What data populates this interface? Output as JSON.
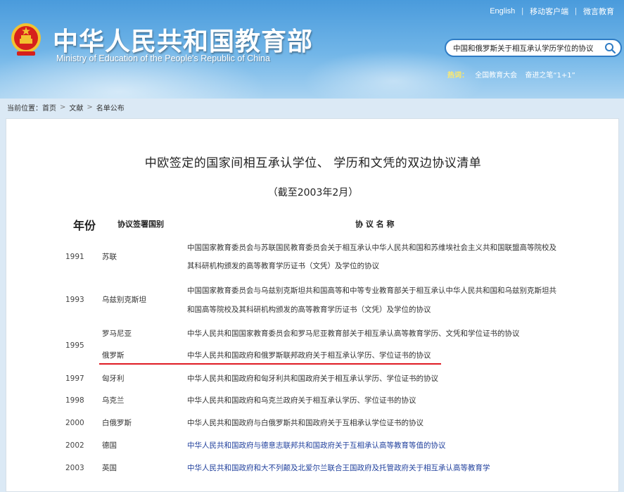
{
  "header": {
    "title_cn": "中华人民共和国教育部",
    "title_en": "Ministry of Education of the People's Republic of China",
    "top_links": [
      "English",
      "移动客户端",
      "微言教育"
    ],
    "search_value": "中国和俄罗斯关于相互承认学历学位的协议",
    "hot_label": "热词：",
    "hot_words": [
      "全国教育大会",
      "奋进之笔“1+1”"
    ]
  },
  "breadcrumb": {
    "label": "当前位置：",
    "items": [
      "首页",
      "文献",
      "名单公布"
    ]
  },
  "document": {
    "title": "中欧签定的国家间相互承认学位、 学历和文凭的双边协议清单",
    "subtitle": "（截至2003年2月）",
    "headers": {
      "year": "年份",
      "country": "协议签署国别",
      "name": "协 议 名 称"
    },
    "rows": [
      {
        "year": "1991",
        "country": "苏联",
        "name_line1": "中国国家教育委员会与苏联国民教育委员会关于相互承认中华人民共和国和苏维埃社会主义共和国联盟高等院校及",
        "name_line2": "其科研机构颁发的高等教育学历证书（文凭）及学位的协议"
      },
      {
        "year": "1993",
        "country": "乌兹别克斯坦",
        "name_line1": "中国国家教育委员会与乌兹别克斯坦共和国高等和中等专业教育部关于相互承认中华人民共和国和乌兹别克斯坦共",
        "name_line2": "和国高等院校及其科研机构颁发的高等教育学历证书（文凭）及学位的协议"
      },
      {
        "year": "1995",
        "country_a": "罗马尼亚",
        "country_b": "俄罗斯",
        "name_a": "中华人民共和国国家教育委员会和罗马尼亚教育部关于相互承认高等教育学历、文凭和学位证书的协议",
        "name_b": "中华人民共和国政府和俄罗斯联邦政府关于相互承认学历、学位证书的协议"
      },
      {
        "year": "1997",
        "country": "匈牙利",
        "name": "中华人民共和国政府和匈牙利共和国政府关于相互承认学历、学位证书的协议"
      },
      {
        "year": "1998",
        "country": "乌克兰",
        "name": "中华人民共和国政府和乌克兰政府关于相互承认学历、学位证书的协议"
      },
      {
        "year": "2000",
        "country": "白俄罗斯",
        "name": "中华人民共和国政府与白俄罗斯共和国政府关于互相承认学位证书的协议"
      },
      {
        "year": "2002",
        "country": "德国",
        "name": "中华人民共和国政府与德意志联邦共和国政府关于互相承认高等教育等值的协议"
      },
      {
        "year": "2003",
        "country": "英国",
        "name": "中华人民共和国政府和大不列颠及北爱尔兰联合王国政府及托管政府关于相互承认高等教育学"
      }
    ]
  },
  "colors": {
    "accent_blue": "#2f7cc4",
    "highlight_line": "#e01c24",
    "link_text": "#1f3f9c"
  }
}
